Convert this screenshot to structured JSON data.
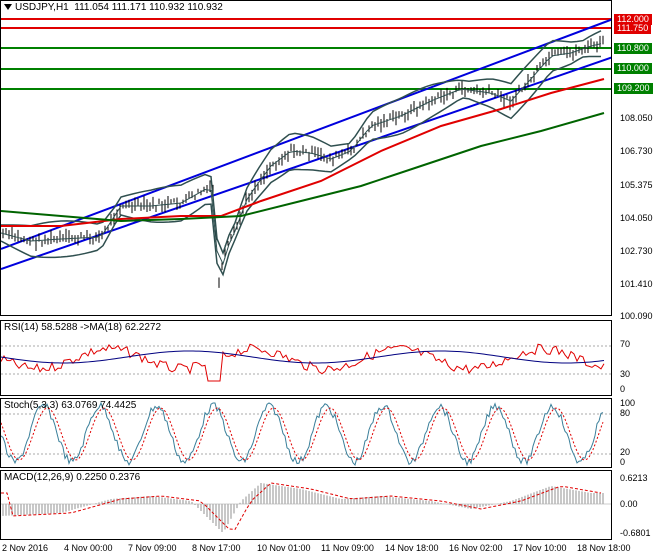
{
  "symbol_header": {
    "symbol": "USDJPY,H1",
    "ohlc": "111.054 111.171 110.932 110.932"
  },
  "main_axis": {
    "ticks": [
      "108.050",
      "106.730",
      "105.375",
      "104.050",
      "102.730",
      "101.410",
      "100.090"
    ],
    "levels": [
      {
        "label": "112.000",
        "color": "#e00000"
      },
      {
        "label": "111.750",
        "color": "#e00000"
      },
      {
        "label": "110.800",
        "color": "#008000"
      },
      {
        "label": "110.000",
        "color": "#008000"
      },
      {
        "label": "109.200",
        "color": "#008000"
      }
    ]
  },
  "rsi": {
    "label": "RSI(14) 58.5288  ->MA(18) 62.2272",
    "ticks": [
      "70",
      "30",
      "0"
    ]
  },
  "stoch": {
    "label": "Stoch(5,3,3) 63.0769 74.4425",
    "ticks": [
      "100",
      "80",
      "20",
      "0"
    ]
  },
  "macd": {
    "label": "MACD(12,26,9) 0.2250 0.2376",
    "ticks": [
      "0.6213",
      "0.00",
      "-0.6801"
    ]
  },
  "time_axis": [
    "2 Nov 2016",
    "4 Nov 00:00",
    "7 Nov 09:00",
    "8 Nov 17:00",
    "10 Nov 01:00",
    "11 Nov 09:00",
    "14 Nov 18:00",
    "16 Nov 02:00",
    "17 Nov 10:00",
    "18 Nov 18:00"
  ],
  "colors": {
    "trend_channel": "#0000dd",
    "resistance": "#e00000",
    "support": "#008000",
    "ma_fast": "#e00000",
    "ma_slow": "#006400",
    "bollinger": "#2f4f4f",
    "rsi_line": "#000080",
    "rsi_ma": "#e00000",
    "stoch_main": "#3a7f9a",
    "stoch_signal": "#e00000",
    "macd_hist": "#b0b0b0",
    "macd_signal": "#e00000"
  }
}
